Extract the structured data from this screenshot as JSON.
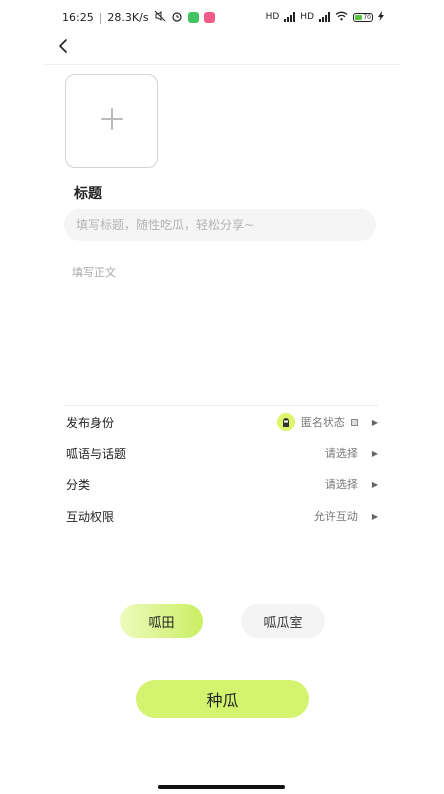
{
  "status_bar": {
    "time": "16:25",
    "speed": "28.3K/s",
    "network_1": "HD",
    "network_2": "HD",
    "battery_level": "70",
    "colors": {
      "app_badge_1": "#43c463",
      "app_badge_2": "#f25c8a",
      "battery_fill": "#56c23a"
    }
  },
  "nav": {
    "back_icon": "chevron-left-icon"
  },
  "upload": {
    "icon": "plus-icon"
  },
  "title_section": {
    "label": "标题",
    "placeholder": "填写标题，随性吃瓜，轻松分享~"
  },
  "body_section": {
    "placeholder": "填写正文"
  },
  "settings": [
    {
      "label": "发布身份",
      "value": "匿名状态"
    },
    {
      "label": "呱语与话题",
      "value": "请选择"
    },
    {
      "label": "分类",
      "value": "请选择"
    },
    {
      "label": "互动权限",
      "value": "允许互动"
    }
  ],
  "segment": {
    "options": [
      "呱田",
      "呱瓜室"
    ],
    "selected": "呱田"
  },
  "submit": {
    "label": "种瓜"
  },
  "colors": {
    "accent": "#d4f36e",
    "accent_light": "#eefabd",
    "input_bg": "#f5f5f5"
  }
}
